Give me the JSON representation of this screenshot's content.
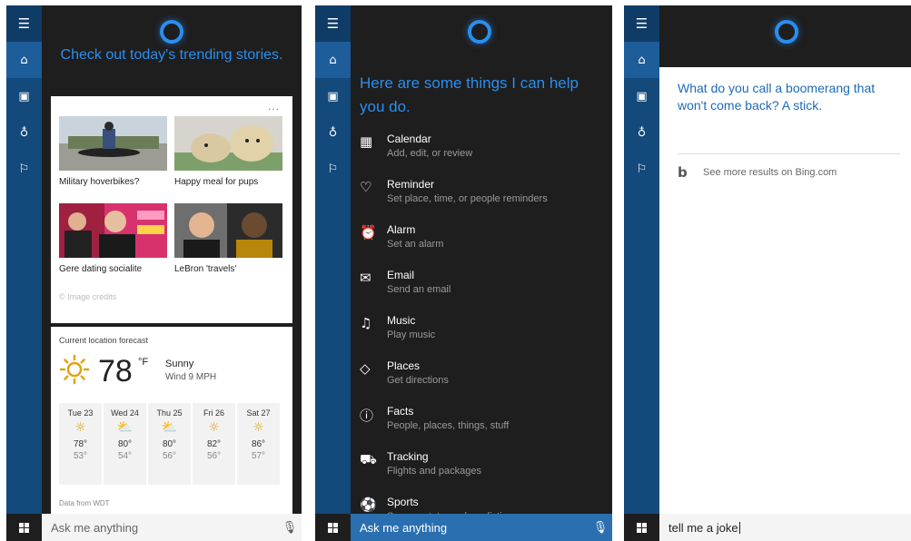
{
  "rail_icons": [
    "hamburger-icon",
    "home-icon",
    "notebook-icon",
    "lightbulb-icon",
    "feedback-icon"
  ],
  "colors": {
    "accent": "#2a8ef0",
    "rail": "#13497b",
    "dark_bg": "#1e1e1e",
    "answer_text": "#1e6ab5"
  },
  "panel1": {
    "header": "Check out today's trending stories.",
    "more": "...",
    "news": [
      {
        "caption": "Military hoverbikes?"
      },
      {
        "caption": "Happy meal for pups"
      },
      {
        "caption": "Gere dating socialite"
      },
      {
        "caption": "LeBron 'travels'"
      }
    ],
    "credits": "© Image credits",
    "weather": {
      "title": "Current location forecast",
      "temp": "78",
      "unit": "°F",
      "condition": "Sunny",
      "wind": "Wind 9 MPH",
      "days": [
        {
          "day": "Tue 23",
          "icon": "sun-icon",
          "glyph": "☼",
          "hi": "78°",
          "lo": "53°"
        },
        {
          "day": "Wed 24",
          "icon": "partly-cloudy-icon",
          "glyph": "⛅",
          "hi": "80°",
          "lo": "54°"
        },
        {
          "day": "Thu 25",
          "icon": "partly-cloudy-icon",
          "glyph": "⛅",
          "hi": "80°",
          "lo": "56°"
        },
        {
          "day": "Fri 26",
          "icon": "sun-icon",
          "glyph": "☼",
          "hi": "82°",
          "lo": "56°"
        },
        {
          "day": "Sat 27",
          "icon": "sun-icon",
          "glyph": "☼",
          "hi": "86°",
          "lo": "57°"
        }
      ],
      "source": "Data from WDT"
    },
    "search_placeholder": "Ask me anything"
  },
  "panel2": {
    "intro": "Here are some things I can help you do.",
    "capabilities": [
      {
        "name": "Calendar",
        "desc": "Add, edit, or review",
        "icon": "calendar-icon",
        "glyph": "▦"
      },
      {
        "name": "Reminder",
        "desc": "Set place, time, or people reminders",
        "icon": "reminder-icon",
        "glyph": "♡"
      },
      {
        "name": "Alarm",
        "desc": "Set an alarm",
        "icon": "alarm-icon",
        "glyph": "⏰"
      },
      {
        "name": "Email",
        "desc": "Send an email",
        "icon": "email-icon",
        "glyph": "✉"
      },
      {
        "name": "Music",
        "desc": "Play music",
        "icon": "music-icon",
        "glyph": "♫"
      },
      {
        "name": "Places",
        "desc": "Get directions",
        "icon": "places-icon",
        "glyph": "◇"
      },
      {
        "name": "Facts",
        "desc": "People, places, things, stuff",
        "icon": "info-icon",
        "glyph": "ⓘ"
      },
      {
        "name": "Tracking",
        "desc": "Flights and packages",
        "icon": "tracking-icon",
        "glyph": "⛟"
      },
      {
        "name": "Sports",
        "desc": "Scores, stats, and predictions",
        "icon": "sports-icon",
        "glyph": "⚽"
      }
    ],
    "search_placeholder": "Ask me anything"
  },
  "panel3": {
    "answer": "What do you call a boomerang that won't come back? A stick.",
    "bing_link": "See more results on Bing.com",
    "query": "tell me a joke"
  }
}
